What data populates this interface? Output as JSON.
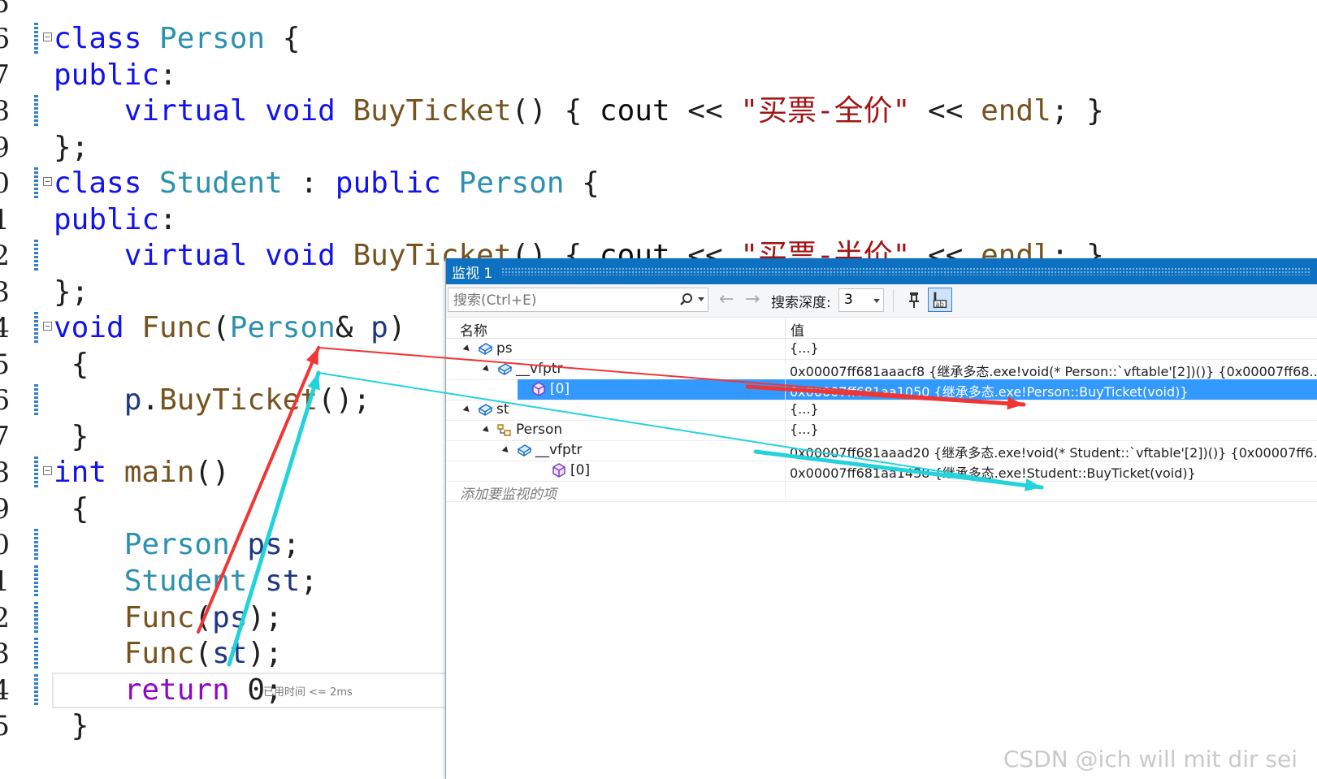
{
  "editor": {
    "lines": [
      {
        "num": "5",
        "tokens": []
      },
      {
        "num": "6",
        "tokens": [
          {
            "t": "class ",
            "c": "kw"
          },
          {
            "t": "Person",
            "c": "ty"
          },
          {
            "t": " {",
            "c": "pu"
          }
        ]
      },
      {
        "num": "7",
        "tokens": [
          {
            "t": "public",
            "c": "kw"
          },
          {
            "t": ":",
            "c": "pu"
          }
        ]
      },
      {
        "num": "8",
        "tokens": [
          {
            "t": "    virtual ",
            "c": "kw"
          },
          {
            "t": "void ",
            "c": "kw"
          },
          {
            "t": "BuyTicket",
            "c": "fn"
          },
          {
            "t": "() { ",
            "c": "pu"
          },
          {
            "t": "cout",
            "c": "cu"
          },
          {
            "t": " << ",
            "c": "pu"
          },
          {
            "t": "\"买票-全价\"",
            "c": "st"
          },
          {
            "t": " << ",
            "c": "pu"
          },
          {
            "t": "endl",
            "c": "fn"
          },
          {
            "t": "; }",
            "c": "pu"
          }
        ]
      },
      {
        "num": "9",
        "tokens": [
          {
            "t": "};",
            "c": "pu"
          }
        ]
      },
      {
        "num": "0",
        "tokens": [
          {
            "t": "class ",
            "c": "kw"
          },
          {
            "t": "Student",
            "c": "ty"
          },
          {
            "t": " : ",
            "c": "pu"
          },
          {
            "t": "public ",
            "c": "kw"
          },
          {
            "t": "Person",
            "c": "ty"
          },
          {
            "t": " {",
            "c": "pu"
          }
        ]
      },
      {
        "num": "1",
        "tokens": [
          {
            "t": "public",
            "c": "kw"
          },
          {
            "t": ":",
            "c": "pu"
          }
        ]
      },
      {
        "num": "2",
        "tokens": [
          {
            "t": "    virtual ",
            "c": "kw"
          },
          {
            "t": "void ",
            "c": "kw"
          },
          {
            "t": "BuyTicket",
            "c": "fn"
          },
          {
            "t": "() { ",
            "c": "pu"
          },
          {
            "t": "cout",
            "c": "cu"
          },
          {
            "t": " << ",
            "c": "pu"
          },
          {
            "t": "\"买票-半价\"",
            "c": "st"
          },
          {
            "t": " << ",
            "c": "pu"
          },
          {
            "t": "endl",
            "c": "fn"
          },
          {
            "t": "; }",
            "c": "pu"
          }
        ]
      },
      {
        "num": "3",
        "tokens": [
          {
            "t": "};",
            "c": "pu"
          }
        ]
      },
      {
        "num": "4",
        "tokens": [
          {
            "t": "void ",
            "c": "kw"
          },
          {
            "t": "Func",
            "c": "fn"
          },
          {
            "t": "(",
            "c": "pu"
          },
          {
            "t": "Person",
            "c": "ty"
          },
          {
            "t": "& ",
            "c": "pu"
          },
          {
            "t": "p",
            "c": "vr"
          },
          {
            "t": ")",
            "c": "pu"
          }
        ]
      },
      {
        "num": "5",
        "tokens": [
          {
            "t": " {",
            "c": "pu"
          }
        ]
      },
      {
        "num": "6",
        "tokens": [
          {
            "t": "    p",
            "c": "vr"
          },
          {
            "t": ".",
            "c": "pu"
          },
          {
            "t": "BuyTicket",
            "c": "fn"
          },
          {
            "t": "();",
            "c": "pu"
          }
        ]
      },
      {
        "num": "7",
        "tokens": [
          {
            "t": " }",
            "c": "pu"
          }
        ]
      },
      {
        "num": "8",
        "tokens": [
          {
            "t": "int ",
            "c": "kw"
          },
          {
            "t": "main",
            "c": "fn"
          },
          {
            "t": "()",
            "c": "pu"
          }
        ]
      },
      {
        "num": "9",
        "tokens": [
          {
            "t": " {",
            "c": "pu"
          }
        ]
      },
      {
        "num": "0",
        "tokens": [
          {
            "t": "    Person ",
            "c": "ty"
          },
          {
            "t": "ps",
            "c": "vr"
          },
          {
            "t": ";",
            "c": "pu"
          }
        ]
      },
      {
        "num": "1",
        "tokens": [
          {
            "t": "    Student ",
            "c": "ty"
          },
          {
            "t": "st",
            "c": "vr"
          },
          {
            "t": ";",
            "c": "pu"
          }
        ]
      },
      {
        "num": "2",
        "tokens": [
          {
            "t": "    Func",
            "c": "fn"
          },
          {
            "t": "(",
            "c": "pu"
          },
          {
            "t": "ps",
            "c": "vr"
          },
          {
            "t": ");",
            "c": "pu"
          }
        ]
      },
      {
        "num": "3",
        "tokens": [
          {
            "t": "    Func",
            "c": "fn"
          },
          {
            "t": "(",
            "c": "pu"
          },
          {
            "t": "st",
            "c": "vr"
          },
          {
            "t": ");",
            "c": "pu"
          }
        ]
      },
      {
        "num": "4",
        "tokens": [
          {
            "t": "    return ",
            "c": "rt"
          },
          {
            "t": "0",
            "c": "pu"
          },
          {
            "t": ";",
            "c": "pu"
          }
        ]
      },
      {
        "num": "5",
        "tokens": [
          {
            "t": " }",
            "c": "pu"
          }
        ]
      }
    ],
    "elapsed_hint": "已用时间 <= 2ms"
  },
  "watch": {
    "title": "监视 1",
    "search": {
      "placeholder": "搜索(Ctrl+E)"
    },
    "depth_label": "搜索深度:",
    "depth_value": "3",
    "columns": {
      "name": "名称",
      "value": "值"
    },
    "rows": [
      {
        "name": "ps",
        "value": "{...}",
        "icon": "object-icon"
      },
      {
        "name": "__vfptr",
        "value": "0x00007ff681aaacf8 {继承多态.exe!void(* Person::`vftable'[2])()} {0x00007ff68...",
        "icon": "object-icon"
      },
      {
        "name": "[0]",
        "value": "0x00007ff681aa1050 {继承多态.exe!Person::BuyTicket(void)}",
        "icon": "cube-icon"
      },
      {
        "name": "st",
        "value": "{...}",
        "icon": "object-icon"
      },
      {
        "name": "Person",
        "value": "{...}",
        "icon": "base-class-icon"
      },
      {
        "name": "__vfptr",
        "value": "0x00007ff681aaad20 {继承多态.exe!void(* Student::`vftable'[2])()} {0x00007ff6...",
        "icon": "object-icon"
      },
      {
        "name": "[0]",
        "value": "0x00007ff681aa1438 {继承多态.exe!Student::BuyTicket(void)}",
        "icon": "cube-icon"
      }
    ],
    "add_watch": "添加要监视的项"
  },
  "watermark": "CSDN @ich will mit dir sei",
  "colors": {
    "red_arrow": "#f03535",
    "cyan_arrow": "#22d3dc",
    "title_bar": "#0e70c0",
    "selection": "#3399ff"
  }
}
